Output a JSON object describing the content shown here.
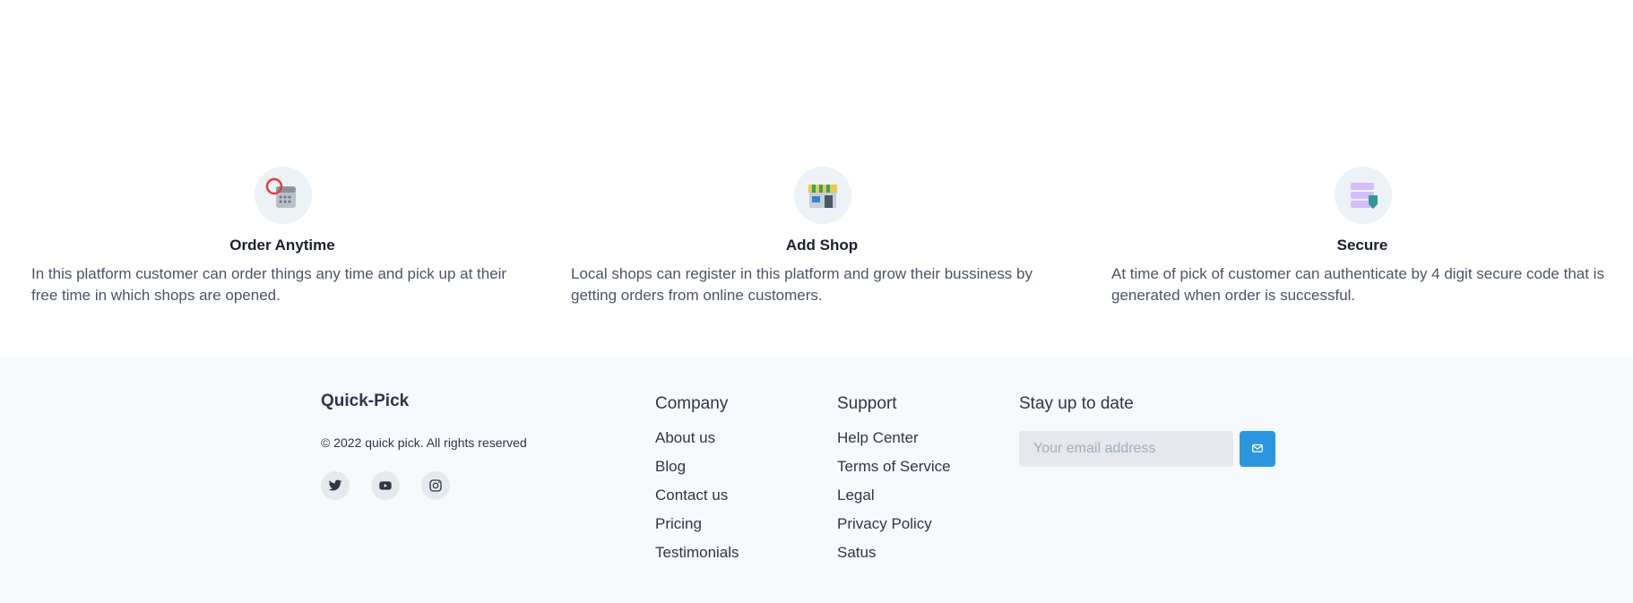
{
  "features": [
    {
      "icon": "order-calendar-icon",
      "title": "Order Anytime",
      "description": "In this platform customer can order things any time and pick up at their free time in which shops are opened."
    },
    {
      "icon": "shop-icon",
      "title": "Add Shop",
      "description": "Local shops can register in this platform and grow their bussiness by getting orders from online customers."
    },
    {
      "icon": "secure-shield-icon",
      "title": "Secure",
      "description": "At time of pick of customer can authenticate by 4 digit secure code that is generated when order is successful."
    }
  ],
  "footer": {
    "brand": "Quick-Pick",
    "copyright": "© 2022 quick pick. All rights reserved",
    "socials": [
      "twitter-icon",
      "youtube-icon",
      "instagram-icon"
    ],
    "company": {
      "title": "Company",
      "links": [
        "About us",
        "Blog",
        "Contact us",
        "Pricing",
        "Testimonials"
      ]
    },
    "support": {
      "title": "Support",
      "links": [
        "Help Center",
        "Terms of Service",
        "Legal",
        "Privacy Policy",
        "Satus"
      ]
    },
    "subscribe": {
      "title": "Stay up to date",
      "placeholder": "Your email address",
      "button_icon": "mail-icon"
    }
  },
  "colors": {
    "accent": "#2b96de",
    "footer_bg": "#f7fafc",
    "icon_circle_bg": "#edf2f7"
  }
}
